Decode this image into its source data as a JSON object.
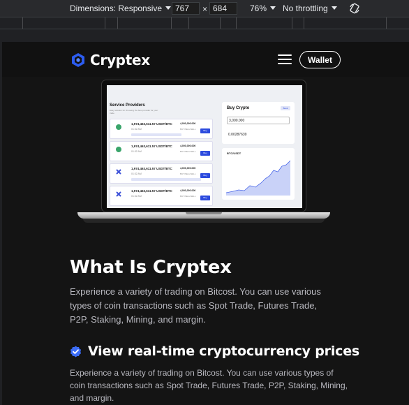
{
  "devtools": {
    "dimensions_label": "Dimensions: Responsive",
    "width": "767",
    "times": "×",
    "height": "684",
    "zoom": "76%",
    "throttling": "No throttling",
    "rotate_icon": "rotate-icon"
  },
  "nav": {
    "brand": "Cryptex",
    "logo_icon": "cube-logo-icon",
    "menu_icon": "hamburger-icon",
    "wallet_label": "Wallet"
  },
  "mockup": {
    "service_title": "Service Providers",
    "service_subtitle": "Easy solution for choosing the best provider for your trade",
    "cards": [
      {
        "amount": "1,974,463,611.57 USDT/BTC",
        "sub": "01:32 AM",
        "price": "4,000,000.000",
        "price_sub": "BUY/SELL/SELL",
        "buy": "Buy"
      },
      {
        "amount": "1,974,463,611.57 USDT/BTC",
        "sub": "01:32 AM",
        "price": "4,000,000.000",
        "price_sub": "BUY/SELL/SELL",
        "buy": "Buy"
      },
      {
        "amount": "1,974,463,611.57 USDT/BTC",
        "sub": "01:32 AM",
        "price": "4,000,000.000",
        "price_sub": "BUY/SELL/SELL",
        "buy": "Buy"
      },
      {
        "amount": "1,974,463,611.57 USDT/BTC",
        "sub": "01:32 AM",
        "price": "4,000,000.000",
        "price_sub": "BUY/SELL/SELL",
        "buy": "Buy"
      }
    ],
    "buy_title": "Buy Crypto",
    "buy_tag": "Book",
    "buy_input": "3,000.000",
    "buy_output": "0.00287639",
    "chart_title": "BTC/USDT"
  },
  "content": {
    "heading": "What Is Cryptex",
    "paragraph": "Experience a variety of trading on Bitcost. You can use various types of coin transactions such as Spot Trade, Futures Trade, P2P, Staking, Mining, and margin.",
    "feature_icon": "check-circle-icon",
    "feature_heading": "View real-time cryptocurrency prices",
    "feature_paragraph": "Experience a variety of trading on Bitcost. You can use various types of coin transactions such as Spot Trade, Futures Trade, P2P, Staking, Mining, and margin."
  },
  "colors": {
    "background": "#141414",
    "nav": "#111111",
    "accent": "#2c4bde",
    "check": "#3b6cf6"
  }
}
